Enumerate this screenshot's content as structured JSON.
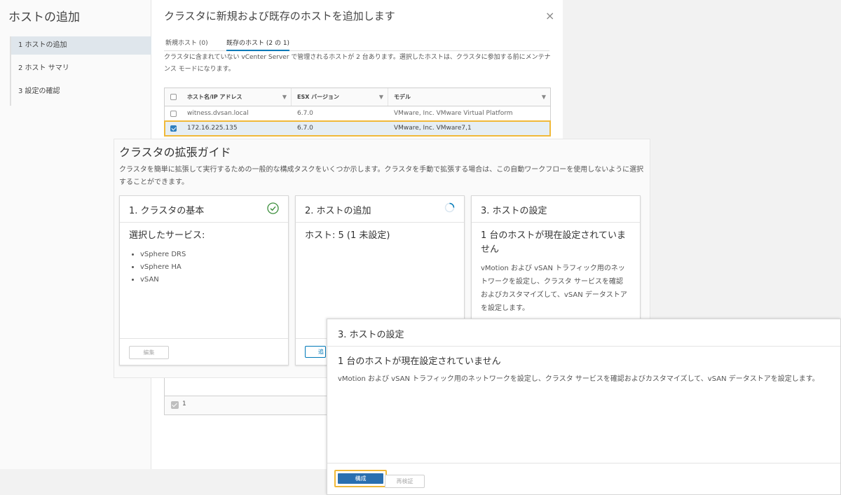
{
  "wizard": {
    "title": "ホストの追加",
    "steps": [
      {
        "label": "1  ホストの追加"
      },
      {
        "label": "2  ホスト サマリ"
      },
      {
        "label": "3  設定の確認"
      }
    ],
    "dialog_title": "クラスタに新規および既存のホストを追加します",
    "close_icon": "×",
    "tabs": [
      {
        "label": "新規ホスト (0)"
      },
      {
        "label": "既存のホスト (2 の 1)"
      }
    ],
    "info_text": "クラスタに含まれていない vCenter Server で管理されるホストが 2 台あります。選択したホストは、クラスタに参加する前にメンテナンス モードになります。",
    "grid": {
      "headers": [
        "ホスト名/IP アドレス",
        "ESX バージョン",
        "モデル"
      ],
      "rows": [
        {
          "host": "witness.dvsan.local",
          "version": "6.7.0",
          "model": "VMware, Inc. VMware Virtual Platform",
          "checked": false
        },
        {
          "host": "172.16.225.135",
          "version": "6.7.0",
          "model": "VMware, Inc. VMware7,1",
          "checked": true
        }
      ],
      "footer_count": "1"
    }
  },
  "guide": {
    "title": "クラスタの拡張ガイド",
    "description": "クラスタを簡単に拡張して実行するための一般的な構成タスクをいくつか示します。クラスタを手動で拡張する場合は、この自動ワークフローを使用しないように選択することができます。",
    "cards": [
      {
        "title": "1. クラスタの基本",
        "status_icon": "check-circle-icon",
        "subtitle": "選択したサービス:",
        "services": [
          "vSphere DRS",
          "vSphere HA",
          "vSAN"
        ],
        "button": "編集"
      },
      {
        "title": "2. ホストの追加",
        "status_icon": "spinner-icon",
        "subtitle": "ホスト: 5 (1 未設定)",
        "button": "追"
      },
      {
        "title": "3. ホストの設定",
        "subtitle": "1 台のホストが現在設定されていません",
        "body": "vMotion および vSAN トラフィック用のネットワークを設定し、クラスタ サービスを確認およびカスタマイズして、vSAN データストアを設定します。"
      }
    ]
  },
  "config_popup": {
    "title": "3. ホストの設定",
    "subtitle": "1 台のホストが現在設定されていません",
    "body": "vMotion および vSAN トラフィック用のネットワークを設定し、クラスタ サービスを確認およびカスタマイズして、vSAN データストアを設定します。",
    "primary_button": "構成",
    "secondary_button": "再検証"
  },
  "colors": {
    "accent": "#0079b8",
    "highlight": "#f0b93a",
    "primary_button": "#2a6fb0",
    "success": "#3c8e3c"
  }
}
